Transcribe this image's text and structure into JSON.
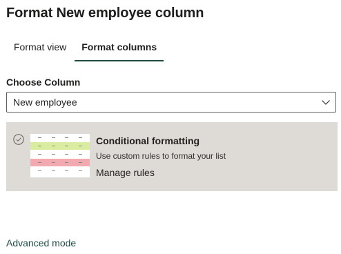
{
  "panel": {
    "title": "Format New employee column"
  },
  "tabs": [
    {
      "label": "Format view",
      "active": false
    },
    {
      "label": "Format columns",
      "active": true
    }
  ],
  "column": {
    "label": "Choose Column",
    "selected": "New employee"
  },
  "card": {
    "title": "Conditional formatting",
    "description": "Use custom rules to format your list",
    "action": "Manage rules"
  },
  "footer": {
    "advanced_label": "Advanced mode"
  },
  "icons": {
    "radio": "check-circle-icon",
    "dropdown": "chevron-down-icon",
    "thumbnail": "conditional-formatting-preview"
  },
  "colors": {
    "accent": "#1c4a42",
    "card_background": "#dedad6",
    "highlight_green": "#d9ec9f",
    "highlight_red": "#f2a9b0"
  }
}
